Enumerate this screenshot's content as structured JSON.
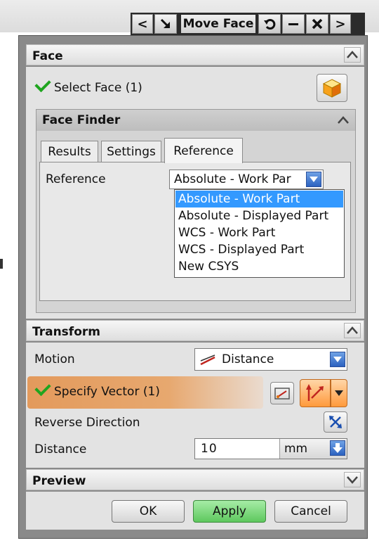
{
  "titlebar": {
    "title": "Move Face",
    "back_glyph": "<",
    "forward_glyph": ">",
    "pin_icon": "arrow-down-right-icon",
    "reset_icon": "reset-icon",
    "minimize_icon": "minimize-icon",
    "close_icon": "close-icon"
  },
  "face_section": {
    "header": "Face",
    "select_face_label": "Select Face (1)",
    "face_finder": {
      "header": "Face Finder",
      "tabs": [
        {
          "label": "Results",
          "active": false
        },
        {
          "label": "Settings",
          "active": false
        },
        {
          "label": "Reference",
          "active": true
        }
      ],
      "reference_label": "Reference",
      "reference_value": "Absolute - Work Par",
      "reference_options": [
        "Absolute - Work Part",
        "Absolute - Displayed Part",
        "WCS - Work Part",
        "WCS - Displayed Part",
        "New CSYS"
      ],
      "highlighted_option_index": 0
    }
  },
  "transform_section": {
    "header": "Transform",
    "motion_label": "Motion",
    "motion_value": "Distance",
    "specify_vector_label": "Specify Vector (1)",
    "reverse_direction_label": "Reverse Direction",
    "distance_label": "Distance",
    "distance_value": "10",
    "distance_unit": "mm"
  },
  "preview_section": {
    "header": "Preview"
  },
  "buttons": {
    "ok": "OK",
    "apply": "Apply",
    "cancel": "Cancel"
  },
  "colors": {
    "check_green": "#1fa51f",
    "highlight_blue": "#3399ff",
    "vector_row_orange": "#e39a5c",
    "apply_green": "#6fd06f"
  }
}
